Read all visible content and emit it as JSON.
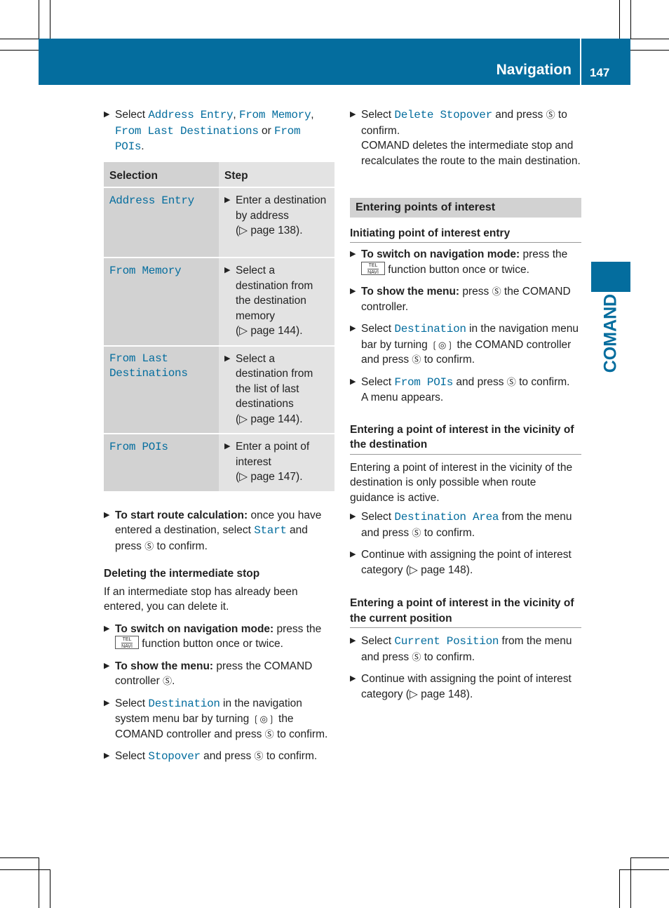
{
  "header": {
    "title": "Navigation",
    "page_number": "147",
    "color": "#046d9e"
  },
  "side_tab": {
    "label": "COMAND"
  },
  "left": {
    "intro": {
      "pre": "Select ",
      "opt1": "Address Entry",
      "c1": ", ",
      "opt2": "From Memory",
      "c2": ",",
      "opt3": "From Last Destinations",
      "or": " or ",
      "opt4": "From POIs",
      "end": "."
    },
    "table": {
      "headers": [
        "Selection",
        "Step"
      ],
      "rows": [
        {
          "selection": "Address Entry",
          "step": "Enter a destination by address",
          "ref": "(▷ page 138)."
        },
        {
          "selection": "From Memory",
          "step": "Select a destination from the destination memory",
          "ref": "(▷ page 144)."
        },
        {
          "selection": "From Last Destinations",
          "step": "Select a destination from the list of last destinations",
          "ref": "(▷ page 144)."
        },
        {
          "selection": "From POIs",
          "step": "Enter a point of interest",
          "ref": "(▷ page 147)."
        }
      ]
    },
    "route": {
      "bold": "To start route calculation:",
      "t1": " once you have entered a destination, select ",
      "opt": "Start",
      "t2": " and press ",
      "t3": " to confirm."
    },
    "delete_heading": "Deleting the intermediate stop",
    "delete_intro": "If an intermediate stop has already been entered, you can delete it.",
    "s1": {
      "bold": "To switch on navigation mode:",
      "t1": " press the ",
      "t2": " function button once or twice."
    },
    "s2": {
      "bold": "To show the menu:",
      "t1": " press the COMAND controller ",
      "t2": "."
    },
    "s3": {
      "pre": "Select ",
      "opt": "Destination",
      "t1": " in the navigation system menu bar by turning ",
      "t2": " the COMAND controller and press ",
      "t3": " to confirm."
    },
    "s4": {
      "pre": "Select ",
      "opt": "Stopover",
      "t1": " and press ",
      "t2": " to confirm."
    }
  },
  "right": {
    "s1": {
      "pre": "Select ",
      "opt": "Delete Stopover",
      "t1": " and press ",
      "t2": " to confirm.",
      "note": "COMAND deletes the intermediate stop and recalculates the route to the main destination."
    },
    "section_title": "Entering points of interest",
    "sub1": "Initiating point of interest entry",
    "a1": {
      "bold": "To switch on navigation mode:",
      "t1": " press the ",
      "t2": " function button once or twice."
    },
    "a2": {
      "bold": "To show the menu:",
      "t1": " press ",
      "t2": " the COMAND controller."
    },
    "a3": {
      "pre": "Select ",
      "opt": "Destination",
      "t1": " in the navigation menu bar by turning ",
      "t2": " the COMAND controller and press ",
      "t3": " to confirm."
    },
    "a4": {
      "pre": "Select ",
      "opt": "From POIs",
      "t1": " and press ",
      "t2": " to confirm.",
      "note": "A menu appears."
    },
    "sub2": "Entering a point of interest in the vicinity of the destination",
    "sub2_intro": "Entering a point of interest in the vicinity of the destination is only possible when route guidance is active.",
    "b1": {
      "pre": "Select ",
      "opt": "Destination Area",
      "t1": " from the menu and press ",
      "t2": " to confirm."
    },
    "b2": {
      "text": "Continue with assigning the point of interest category (▷ page 148)."
    },
    "sub3": "Entering a point of interest in the vicinity of the current position",
    "c1": {
      "pre": "Select ",
      "opt": "Current Position",
      "t1": " from the menu and press ",
      "t2": " to confirm."
    },
    "c2": {
      "text": "Continue with assigning the point of interest category (▷ page 148)."
    }
  },
  "icons": {
    "press": "Ⓢ",
    "turn": "❲◎❳",
    "tel": "TEL",
    "navi": "NAVI"
  }
}
